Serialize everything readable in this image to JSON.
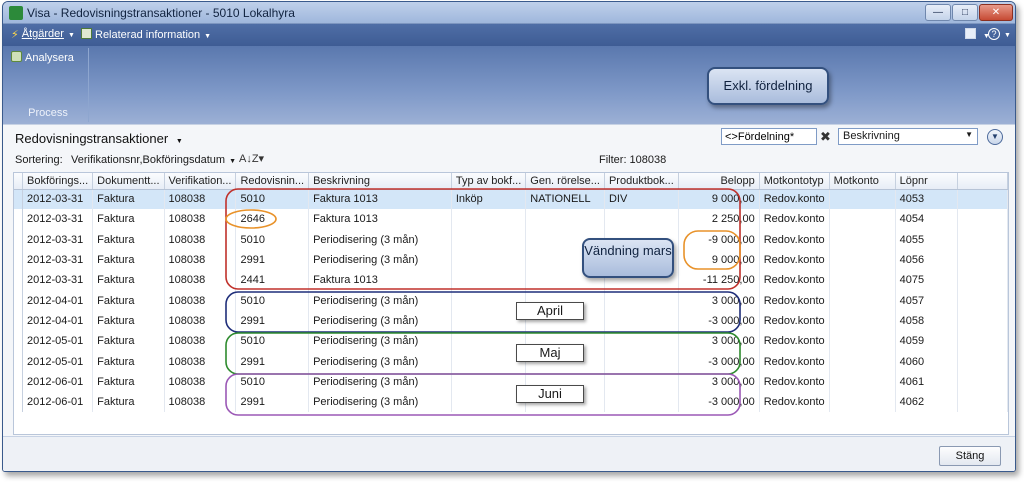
{
  "window": {
    "title": "Visa - Redovisningstransaktioner - 5010 Lokalhyra"
  },
  "menubar": {
    "actions": "Åtgärder",
    "related": "Relaterad information",
    "view_icon": "view-icon",
    "help": "?"
  },
  "ribbon": {
    "analyze_label": "Analysera",
    "group_label": "Process"
  },
  "callouts": {
    "exkl": "Exkl. fördelning",
    "vandning": "Vändning mars",
    "april": "April",
    "maj": "Maj",
    "juni": "Juni"
  },
  "page": {
    "title": "Redovisningstransaktioner",
    "sort_label": "Sortering:",
    "sort_value": "Verifikationsnr,Bokföringsdatum",
    "filter_text": "Filter: 108038",
    "filter_input": "<>Fördelning*",
    "filter_field": "Beskrivning"
  },
  "table": {
    "columns": [
      "Bokförings...",
      "Dokumentt...",
      "Verifikation...",
      "Redovisnin...",
      "Beskrivning",
      "Typ av bokf...",
      "Gen. rörelse...",
      "Produktbok...",
      "Belopp",
      "Motkontotyp",
      "Motkonto",
      "Löpnr"
    ],
    "rows": [
      [
        "2012-03-31",
        "Faktura",
        "108038",
        "5010",
        "Faktura 1013",
        "Inköp",
        "NATIONELL",
        "DIV",
        "9 000,00",
        "Redov.konto",
        "",
        "4053"
      ],
      [
        "2012-03-31",
        "Faktura",
        "108038",
        "2646",
        "Faktura 1013",
        "",
        "",
        "",
        "2 250,00",
        "Redov.konto",
        "",
        "4054"
      ],
      [
        "2012-03-31",
        "Faktura",
        "108038",
        "5010",
        "Periodisering (3 mån)",
        "",
        "",
        "",
        "-9 000,00",
        "Redov.konto",
        "",
        "4055"
      ],
      [
        "2012-03-31",
        "Faktura",
        "108038",
        "2991",
        "Periodisering (3 mån)",
        "",
        "",
        "",
        "9 000,00",
        "Redov.konto",
        "",
        "4056"
      ],
      [
        "2012-03-31",
        "Faktura",
        "108038",
        "2441",
        "Faktura 1013",
        "",
        "",
        "",
        "-11 250,00",
        "Redov.konto",
        "",
        "4075"
      ],
      [
        "2012-04-01",
        "Faktura",
        "108038",
        "5010",
        "Periodisering (3 mån)",
        "",
        "",
        "",
        "3 000,00",
        "Redov.konto",
        "",
        "4057"
      ],
      [
        "2012-04-01",
        "Faktura",
        "108038",
        "2991",
        "Periodisering (3 mån)",
        "",
        "",
        "",
        "-3 000,00",
        "Redov.konto",
        "",
        "4058"
      ],
      [
        "2012-05-01",
        "Faktura",
        "108038",
        "5010",
        "Periodisering (3 mån)",
        "",
        "",
        "",
        "3 000,00",
        "Redov.konto",
        "",
        "4059"
      ],
      [
        "2012-05-01",
        "Faktura",
        "108038",
        "2991",
        "Periodisering (3 mån)",
        "",
        "",
        "",
        "-3 000,00",
        "Redov.konto",
        "",
        "4060"
      ],
      [
        "2012-06-01",
        "Faktura",
        "108038",
        "5010",
        "Periodisering (3 mån)",
        "",
        "",
        "",
        "3 000,00",
        "Redov.konto",
        "",
        "4061"
      ],
      [
        "2012-06-01",
        "Faktura",
        "108038",
        "2991",
        "Periodisering (3 mån)",
        "",
        "",
        "",
        "-3 000,00",
        "Redov.konto",
        "",
        "4062"
      ]
    ],
    "selected_row": 0
  },
  "footer": {
    "close_label": "Stäng"
  },
  "colors": {
    "accent": "#3e5c94",
    "selection": "#d3e6f8",
    "red": "#c0312b",
    "orange": "#e8922a",
    "navy": "#1f2e7a",
    "green": "#2e8b2e",
    "purple": "#9b59b6"
  }
}
